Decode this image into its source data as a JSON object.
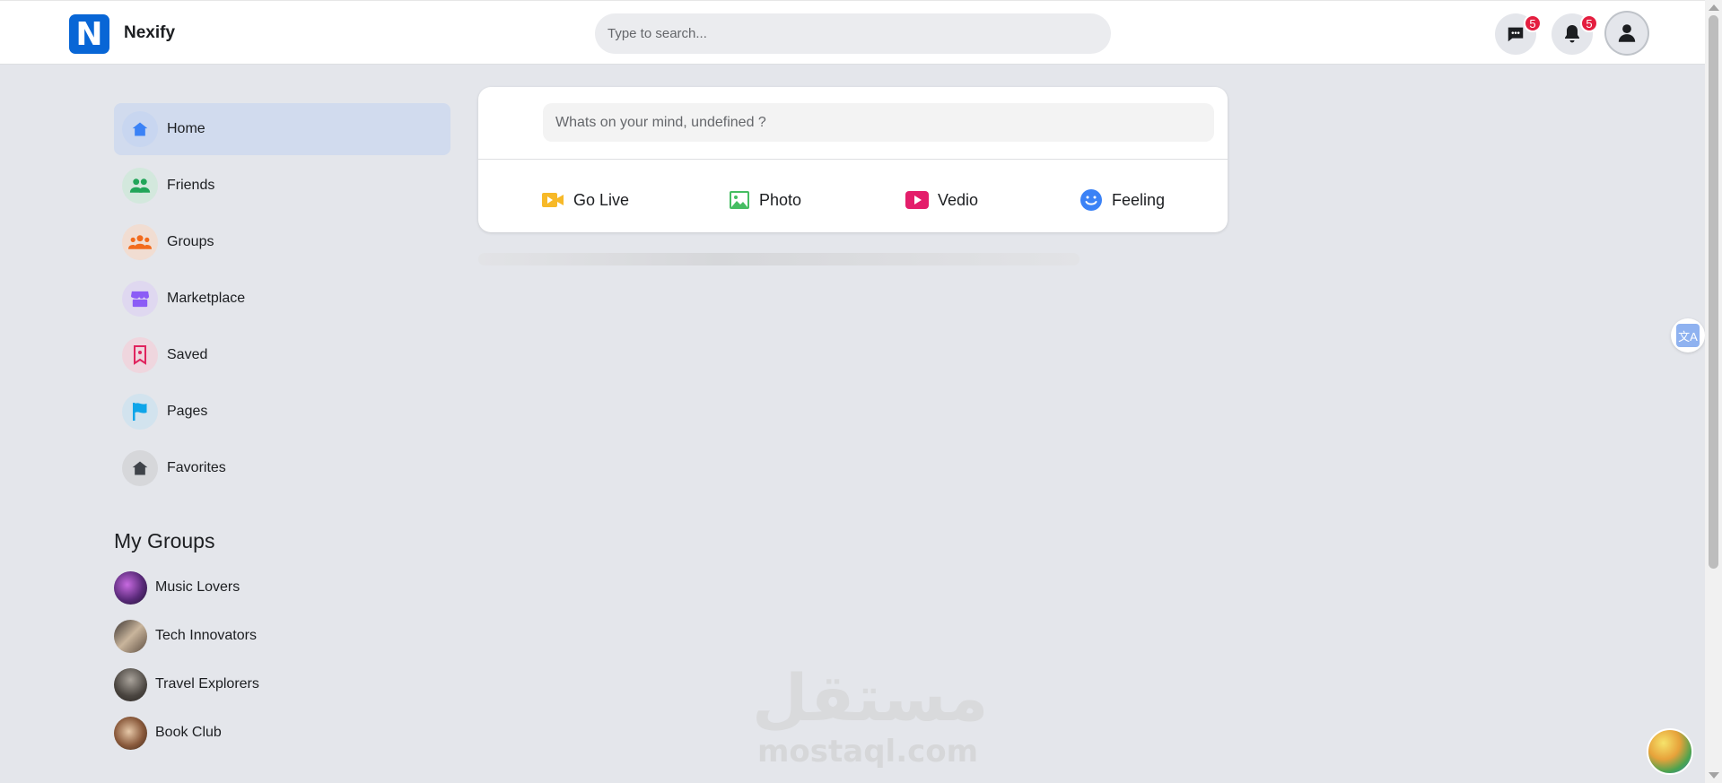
{
  "header": {
    "logo_letter": "N",
    "brand": "Nexify",
    "search_placeholder": "Type to search...",
    "messages_badge": "5",
    "notifications_badge": "5"
  },
  "sidebar": {
    "items": [
      {
        "label": "Home",
        "icon": "home-icon",
        "color": "#3b82f6",
        "bg": "#c8d6f0",
        "active": true
      },
      {
        "label": "Friends",
        "icon": "friends-icon",
        "color": "#22a559",
        "bg": "#d3e8dd",
        "active": false
      },
      {
        "label": "Groups",
        "icon": "groups-icon",
        "color": "#f26b1d",
        "bg": "#f1ddd2",
        "active": false
      },
      {
        "label": "Marketplace",
        "icon": "store-icon",
        "color": "#8b5cf6",
        "bg": "#dfd8f0",
        "active": false
      },
      {
        "label": "Saved",
        "icon": "bookmark-icon",
        "color": "#e0245e",
        "bg": "#efd6de",
        "active": false
      },
      {
        "label": "Pages",
        "icon": "flag-icon",
        "color": "#0ea5e9",
        "bg": "#d2e3ee",
        "active": false
      },
      {
        "label": "Favorites",
        "icon": "home-dark-icon",
        "color": "#3f4349",
        "bg": "#d6d7da",
        "active": false
      }
    ],
    "my_groups_title": "My Groups",
    "groups": [
      {
        "name": "Music Lovers"
      },
      {
        "name": "Tech Innovators"
      },
      {
        "name": "Travel Explorers"
      },
      {
        "name": "Book Club"
      }
    ]
  },
  "composer": {
    "placeholder": "Whats on your mind, undefined ?",
    "actions": [
      {
        "label": "Go Live",
        "icon": "video-camera-icon",
        "color": "#f7b928"
      },
      {
        "label": "Photo",
        "icon": "photo-icon",
        "color": "#45bd62"
      },
      {
        "label": "Vedio",
        "icon": "youtube-icon",
        "color": "#e41e6b"
      },
      {
        "label": "Feeling",
        "icon": "smile-icon",
        "color": "#3b82f6"
      }
    ]
  },
  "watermark": {
    "arabic": "مستقل",
    "latin": "mostaql.com"
  },
  "translate_glyph": "文A"
}
